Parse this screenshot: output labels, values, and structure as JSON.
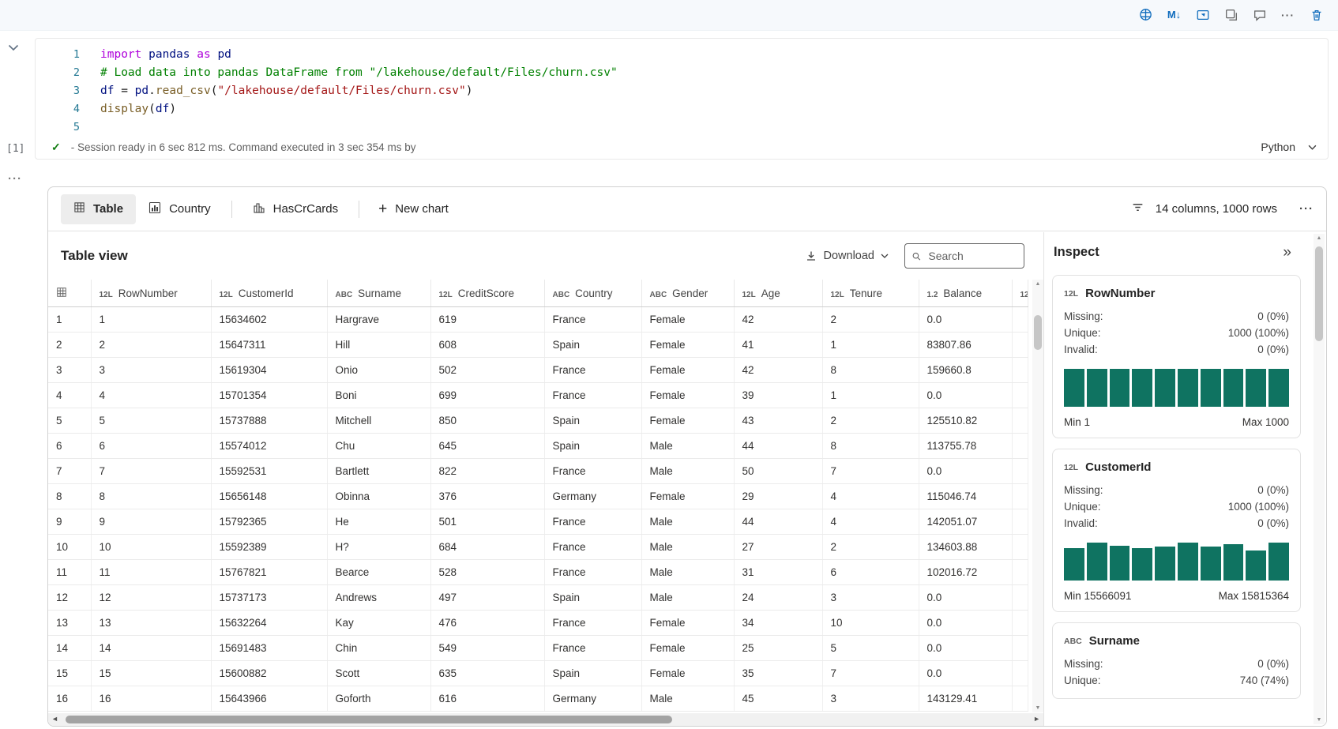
{
  "colors": {
    "accent_blue": "#0f6cbd",
    "histogram_teal": "#0f7361",
    "success_green": "#107c10"
  },
  "icons": {
    "markdown_glyph": "M↓",
    "more_horizontal": "···",
    "plus": "+",
    "double_chevron_right": "»",
    "check": "✓",
    "scroll_up": "▲",
    "scroll_down": "▼",
    "scroll_left": "◄",
    "scroll_right": "►"
  },
  "cell_toolbar_icon_names": [
    "data-wrangler-icon",
    "markdown-icon",
    "convert-cell-icon",
    "split-cell-icon",
    "comment-icon",
    "more-options-icon",
    "delete-icon"
  ],
  "cell": {
    "execution_count": "[1]",
    "status": "- Session ready in 6 sec 812 ms. Command executed in 3 sec 354 ms by",
    "language": "Python",
    "code_lines": [
      {
        "n": "1",
        "tokens": [
          [
            "k",
            "import"
          ],
          [
            "p",
            " "
          ],
          [
            "v",
            "pandas"
          ],
          [
            "p",
            " "
          ],
          [
            "k",
            "as"
          ],
          [
            "p",
            " "
          ],
          [
            "v",
            "pd"
          ]
        ]
      },
      {
        "n": "2",
        "tokens": [
          [
            "c",
            "# Load data into pandas DataFrame from \"/lakehouse/default/Files/churn.csv\""
          ]
        ]
      },
      {
        "n": "3",
        "tokens": [
          [
            "v",
            "df"
          ],
          [
            "p",
            " = "
          ],
          [
            "v",
            "pd"
          ],
          [
            "p",
            "."
          ],
          [
            "f",
            "read_csv"
          ],
          [
            "p",
            "("
          ],
          [
            "s",
            "\"/lakehouse/default/Files/churn.csv\""
          ],
          [
            "p",
            ")"
          ]
        ]
      },
      {
        "n": "4",
        "tokens": [
          [
            "f",
            "display"
          ],
          [
            "p",
            "("
          ],
          [
            "v",
            "df"
          ],
          [
            "p",
            ")"
          ]
        ]
      },
      {
        "n": "5",
        "tokens": []
      }
    ]
  },
  "results": {
    "tabs": [
      {
        "label": "Table",
        "active": true
      },
      {
        "label": "Country",
        "active": false
      },
      {
        "label": "HasCrCards",
        "active": false
      }
    ],
    "new_chart_label": "New chart",
    "summary": "14 columns, 1000 rows",
    "table_view": {
      "title": "Table view",
      "download_label": "Download",
      "search_placeholder": "Search",
      "columns": [
        {
          "type": "12L",
          "name": "RowNumber"
        },
        {
          "type": "12L",
          "name": "CustomerId"
        },
        {
          "type": "ABC",
          "name": "Surname"
        },
        {
          "type": "12L",
          "name": "CreditScore"
        },
        {
          "type": "ABC",
          "name": "Country"
        },
        {
          "type": "ABC",
          "name": "Gender"
        },
        {
          "type": "12L",
          "name": "Age"
        },
        {
          "type": "12L",
          "name": "Tenure"
        },
        {
          "type": "1.2",
          "name": "Balance"
        },
        {
          "type": "12L",
          "name": ""
        }
      ],
      "rows": [
        {
          "index": "1",
          "cells": [
            "1",
            "15634602",
            "Hargrave",
            "619",
            "France",
            "Female",
            "42",
            "2",
            "0.0",
            ""
          ]
        },
        {
          "index": "2",
          "cells": [
            "2",
            "15647311",
            "Hill",
            "608",
            "Spain",
            "Female",
            "41",
            "1",
            "83807.86",
            ""
          ]
        },
        {
          "index": "3",
          "cells": [
            "3",
            "15619304",
            "Onio",
            "502",
            "France",
            "Female",
            "42",
            "8",
            "159660.8",
            ""
          ]
        },
        {
          "index": "4",
          "cells": [
            "4",
            "15701354",
            "Boni",
            "699",
            "France",
            "Female",
            "39",
            "1",
            "0.0",
            ""
          ]
        },
        {
          "index": "5",
          "cells": [
            "5",
            "15737888",
            "Mitchell",
            "850",
            "Spain",
            "Female",
            "43",
            "2",
            "125510.82",
            ""
          ]
        },
        {
          "index": "6",
          "cells": [
            "6",
            "15574012",
            "Chu",
            "645",
            "Spain",
            "Male",
            "44",
            "8",
            "113755.78",
            ""
          ]
        },
        {
          "index": "7",
          "cells": [
            "7",
            "15592531",
            "Bartlett",
            "822",
            "France",
            "Male",
            "50",
            "7",
            "0.0",
            ""
          ]
        },
        {
          "index": "8",
          "cells": [
            "8",
            "15656148",
            "Obinna",
            "376",
            "Germany",
            "Female",
            "29",
            "4",
            "115046.74",
            ""
          ]
        },
        {
          "index": "9",
          "cells": [
            "9",
            "15792365",
            "He",
            "501",
            "France",
            "Male",
            "44",
            "4",
            "142051.07",
            ""
          ]
        },
        {
          "index": "10",
          "cells": [
            "10",
            "15592389",
            "H?",
            "684",
            "France",
            "Male",
            "27",
            "2",
            "134603.88",
            ""
          ]
        },
        {
          "index": "11",
          "cells": [
            "11",
            "15767821",
            "Bearce",
            "528",
            "France",
            "Male",
            "31",
            "6",
            "102016.72",
            ""
          ]
        },
        {
          "index": "12",
          "cells": [
            "12",
            "15737173",
            "Andrews",
            "497",
            "Spain",
            "Male",
            "24",
            "3",
            "0.0",
            ""
          ]
        },
        {
          "index": "13",
          "cells": [
            "13",
            "15632264",
            "Kay",
            "476",
            "France",
            "Female",
            "34",
            "10",
            "0.0",
            ""
          ]
        },
        {
          "index": "14",
          "cells": [
            "14",
            "15691483",
            "Chin",
            "549",
            "France",
            "Female",
            "25",
            "5",
            "0.0",
            ""
          ]
        },
        {
          "index": "15",
          "cells": [
            "15",
            "15600882",
            "Scott",
            "635",
            "Spain",
            "Female",
            "35",
            "7",
            "0.0",
            ""
          ]
        },
        {
          "index": "16",
          "cells": [
            "16",
            "15643966",
            "Goforth",
            "616",
            "Germany",
            "Male",
            "45",
            "3",
            "143129.41",
            ""
          ]
        }
      ]
    },
    "inspect": {
      "title": "Inspect",
      "cards": [
        {
          "type": "12L",
          "name": "RowNumber",
          "stats": [
            {
              "label": "Missing:",
              "value": "0 (0%)"
            },
            {
              "label": "Unique:",
              "value": "1000 (100%)"
            },
            {
              "label": "Invalid:",
              "value": "0 (0%)"
            }
          ],
          "histogram": [
            100,
            100,
            100,
            100,
            100,
            100,
            100,
            100,
            100,
            100
          ],
          "min": "Min 1",
          "max": "Max 1000"
        },
        {
          "type": "12L",
          "name": "CustomerId",
          "stats": [
            {
              "label": "Missing:",
              "value": "0 (0%)"
            },
            {
              "label": "Unique:",
              "value": "1000 (100%)"
            },
            {
              "label": "Invalid:",
              "value": "0 (0%)"
            }
          ],
          "histogram": [
            85,
            100,
            92,
            86,
            90,
            100,
            90,
            95,
            80,
            100
          ],
          "min": "Min 15566091",
          "max": "Max 15815364"
        },
        {
          "type": "ABC",
          "name": "Surname",
          "stats": [
            {
              "label": "Missing:",
              "value": "0 (0%)"
            },
            {
              "label": "Unique:",
              "value": "740 (74%)"
            }
          ],
          "histogram": null,
          "min": "",
          "max": ""
        }
      ]
    }
  }
}
